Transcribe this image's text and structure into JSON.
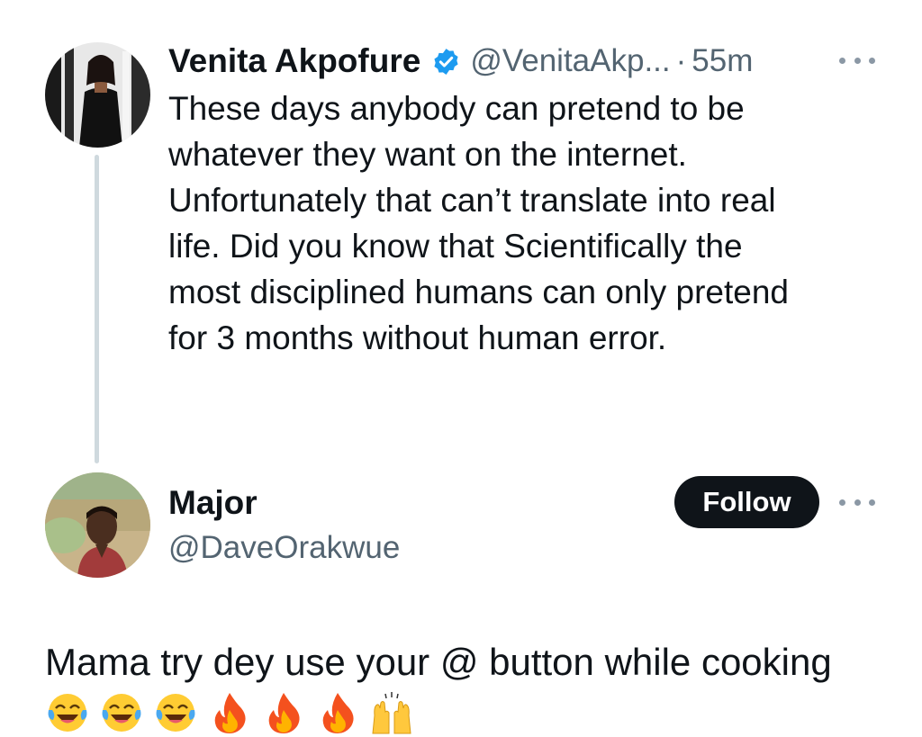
{
  "tweet": {
    "author": {
      "display_name": "Venita Akpofure",
      "handle": "@VenitaAkp...",
      "verified": true
    },
    "separator": "·",
    "timestamp": "55m",
    "text": "These days anybody can pretend to be\nwhatever they want on the internet.\nUnfortunately that can’t translate into real\nlife. Did you know that Scientifically the\nmost disciplined humans can only pretend\nfor 3 months without human error."
  },
  "reply": {
    "author": {
      "display_name": "Major",
      "handle": "@DaveOrakwue"
    },
    "follow_label": "Follow"
  },
  "comment": {
    "text": "Mama try dey use your @ button while cooking",
    "emojis": [
      "face-with-tears-of-joy",
      "face-with-tears-of-joy",
      "face-with-tears-of-joy",
      "fire",
      "fire",
      "fire",
      "raising-hands"
    ]
  },
  "colors": {
    "text_primary": "#0f1419",
    "text_secondary": "#536471",
    "verified_blue": "#1d9bf0",
    "thread_line": "#cfd9de",
    "follow_bg": "#0f1419"
  }
}
